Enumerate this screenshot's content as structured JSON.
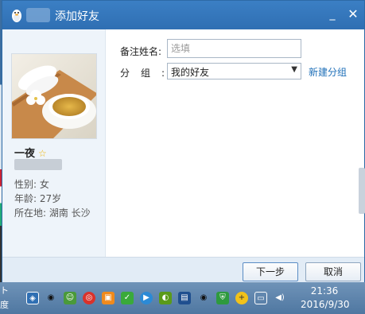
{
  "window": {
    "title": "添加好友",
    "minimize_glyph": "_",
    "close_glyph": "✕"
  },
  "profile": {
    "nickname": "一夜",
    "gender": "性别: 女",
    "age": "年龄: 27岁",
    "location": "所在地: 湖南  长沙"
  },
  "form": {
    "remark_label": "备注姓名:",
    "remark_placeholder": "选填",
    "remark_value": "",
    "group_label": "分组:",
    "group_selected": "我的好友",
    "new_group_link": "新建分组"
  },
  "buttons": {
    "next": "下一步",
    "cancel": "取消"
  },
  "taskbar": {
    "left_text_1": "ト",
    "left_text_2": "度",
    "time": "21:36",
    "date": "2016/9/30"
  },
  "icons": [
    "qq-penguin-icon",
    "shield-icon",
    "qq-icon",
    "qq-friend-icon",
    "weibo-icon",
    "gift-icon",
    "wechat-icon",
    "player-icon",
    "nvidia-icon",
    "film-icon",
    "qq-icon",
    "security-icon",
    "plus-icon",
    "network-icon",
    "volume-icon"
  ]
}
